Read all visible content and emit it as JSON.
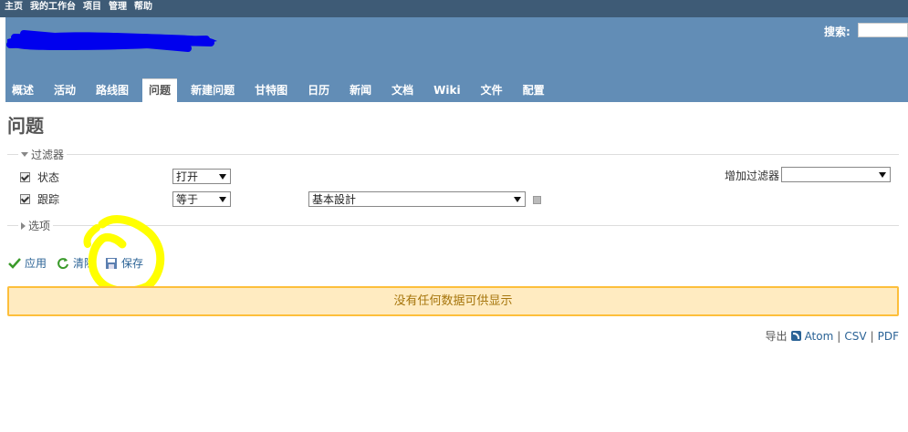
{
  "top_menu": {
    "items": [
      "主页",
      "我的工作台",
      "项目",
      "管理",
      "帮助"
    ]
  },
  "header": {
    "search_label": "搜索:",
    "search_value": ""
  },
  "tabs": [
    {
      "label": "概述",
      "selected": false
    },
    {
      "label": "活动",
      "selected": false
    },
    {
      "label": "路线图",
      "selected": false
    },
    {
      "label": "问题",
      "selected": true
    },
    {
      "label": "新建问题",
      "selected": false
    },
    {
      "label": "甘特图",
      "selected": false
    },
    {
      "label": "日历",
      "selected": false
    },
    {
      "label": "新闻",
      "selected": false
    },
    {
      "label": "文档",
      "selected": false
    },
    {
      "label": "Wiki",
      "selected": false
    },
    {
      "label": "文件",
      "selected": false
    },
    {
      "label": "配置",
      "selected": false
    }
  ],
  "page": {
    "title": "问题"
  },
  "filters": {
    "legend": "过滤器",
    "rows": [
      {
        "label": "状态",
        "checked": true,
        "operator": "打开"
      },
      {
        "label": "跟踪",
        "checked": true,
        "operator": "等于",
        "value": "基本設計"
      }
    ],
    "add_filter_label": "增加过滤器",
    "add_filter_value": ""
  },
  "options": {
    "legend": "选项"
  },
  "actions": {
    "apply": "应用",
    "clear": "清除",
    "save": "保存"
  },
  "nodata": "没有任何数据可供显示",
  "export": {
    "label": "导出",
    "atom": "Atom",
    "sep": "|",
    "csv": "CSV",
    "pdf": "PDF"
  },
  "colors": {
    "top_bar": "#3e5b76",
    "header": "#628db6",
    "link": "#2b6396",
    "nodata_bg": "#ffebc1",
    "nodata_border": "#fdbf3b",
    "redaction": "#0000ee",
    "highlight": "#ffff00"
  }
}
